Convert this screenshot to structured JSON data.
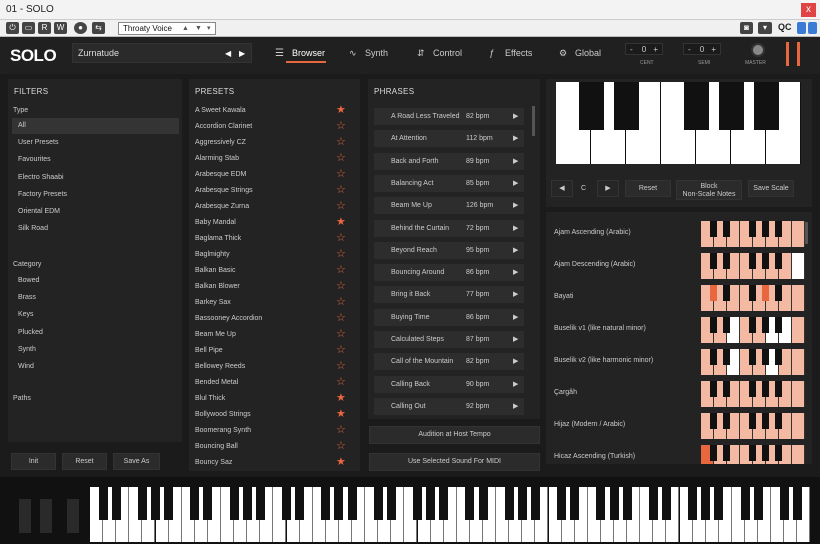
{
  "window": {
    "title": "01 - SOLO",
    "close": "x"
  },
  "host": {
    "preset": "Throaty Voice",
    "qc": "QC"
  },
  "header": {
    "logo": "SOLO",
    "instrument": "Zurnatude",
    "tabs": [
      "Browser",
      "Synth",
      "Control",
      "Effects",
      "Global"
    ],
    "cent_value": "0",
    "cent_label": "CENT",
    "semi_value": "0",
    "semi_label": "SEMI",
    "master_label": "MASTER"
  },
  "filters": {
    "title": "FILTERS",
    "type_label": "Type",
    "types": [
      "All",
      "User Presets",
      "Favourites",
      "Electro Shaabi",
      "Factory Presets",
      "Oriental EDM",
      "Silk Road"
    ],
    "category_label": "Category",
    "categories": [
      "Bowed",
      "Brass",
      "Keys",
      "Plucked",
      "Synth",
      "Wind"
    ],
    "paths_label": "Paths",
    "buttons": [
      "Init",
      "Reset",
      "Save As"
    ]
  },
  "presets": {
    "title": "PRESETS",
    "items": [
      {
        "name": "A Sweet Kawala",
        "fav": true
      },
      {
        "name": "Accordion Clarinet",
        "fav": false
      },
      {
        "name": "Aggressively CZ",
        "fav": false
      },
      {
        "name": "Alarming Stab",
        "fav": false
      },
      {
        "name": "Arabesque EDM",
        "fav": false
      },
      {
        "name": "Arabesque Strings",
        "fav": false
      },
      {
        "name": "Arabesque Zurna",
        "fav": false
      },
      {
        "name": "Baby Mandal",
        "fav": true
      },
      {
        "name": "Baglama Thick",
        "fav": false
      },
      {
        "name": "Baglmighty",
        "fav": false
      },
      {
        "name": "Balkan Basic",
        "fav": false
      },
      {
        "name": "Balkan Blower",
        "fav": false
      },
      {
        "name": "Barkey Sax",
        "fav": false
      },
      {
        "name": "Bassooney Accordion",
        "fav": false
      },
      {
        "name": "Beam Me Up",
        "fav": false
      },
      {
        "name": "Bell Pipe",
        "fav": false
      },
      {
        "name": "Bellowey Reeds",
        "fav": false
      },
      {
        "name": "Bended Metal",
        "fav": false
      },
      {
        "name": "Blul Thick",
        "fav": true
      },
      {
        "name": "Bollywood Strings",
        "fav": true
      },
      {
        "name": "Boomerang Synth",
        "fav": false
      },
      {
        "name": "Bouncing Ball",
        "fav": false
      },
      {
        "name": "Bouncy Saz",
        "fav": true
      }
    ]
  },
  "phrases": {
    "title": "PHRASES",
    "items": [
      {
        "name": "A Road Less Traveled",
        "bpm": "82 bpm"
      },
      {
        "name": "At Attention",
        "bpm": "112 bpm"
      },
      {
        "name": "Back and Forth",
        "bpm": "89 bpm"
      },
      {
        "name": "Balancing Act",
        "bpm": "85 bpm"
      },
      {
        "name": "Beam Me Up",
        "bpm": "126 bpm"
      },
      {
        "name": "Behind the Curtain",
        "bpm": "72 bpm"
      },
      {
        "name": "Beyond Reach",
        "bpm": "95 bpm"
      },
      {
        "name": "Bouncing Around",
        "bpm": "86 bpm"
      },
      {
        "name": "Bring it Back",
        "bpm": "77 bpm"
      },
      {
        "name": "Buying Time",
        "bpm": "86 bpm"
      },
      {
        "name": "Calculated Steps",
        "bpm": "87 bpm"
      },
      {
        "name": "Call of the Mountain",
        "bpm": "82 bpm"
      },
      {
        "name": "Calling Back",
        "bpm": "90 bpm"
      },
      {
        "name": "Calling Out",
        "bpm": "92 bpm"
      }
    ],
    "audition": "Audition at Host Tempo",
    "use_midi": "Use Selected Sound For MIDI"
  },
  "scale": {
    "key": "C",
    "reset": "Reset",
    "block1": "Block",
    "block2": "Non-Scale Notes",
    "save": "Save Scale",
    "items": [
      {
        "name": "Ajam Ascending (Arabic)",
        "w": [
          1,
          1,
          1,
          1,
          1,
          1,
          1,
          1
        ],
        "wd": [],
        "b": [
          1,
          1,
          0,
          1,
          1
        ]
      },
      {
        "name": "Ajam Descending (Arabic)",
        "w": [
          1,
          1,
          1,
          1,
          1,
          1,
          1,
          0
        ],
        "wd": [],
        "b": [
          0,
          0,
          0,
          1,
          1
        ]
      },
      {
        "name": "Bayati",
        "w": [
          1,
          1,
          1,
          1,
          1,
          1,
          1,
          1
        ],
        "wd": [],
        "b": [
          2,
          0,
          0,
          2,
          0
        ]
      },
      {
        "name": "Buselik v1 (like natural minor)",
        "w": [
          1,
          1,
          0,
          1,
          1,
          0,
          0,
          1
        ],
        "wd": [],
        "b": [
          0,
          1,
          0,
          1,
          1
        ]
      },
      {
        "name": "Buselik v2 (like harmonic minor)",
        "w": [
          1,
          1,
          0,
          1,
          1,
          0,
          1,
          1
        ],
        "wd": [],
        "b": [
          0,
          1,
          0,
          1,
          0
        ]
      },
      {
        "name": "Çargâh",
        "w": [
          1,
          1,
          1,
          1,
          1,
          1,
          1,
          1
        ],
        "wd": [],
        "b": [
          0,
          0,
          0,
          0,
          0
        ]
      },
      {
        "name": "Hijaz (Modern / Arabic)",
        "w": [
          1,
          1,
          1,
          1,
          1,
          1,
          1,
          1
        ],
        "wd": [],
        "b": [
          1,
          0,
          0,
          1,
          0
        ]
      },
      {
        "name": "Hicaz Ascending (Turkish)",
        "w": [
          1,
          1,
          1,
          1,
          1,
          1,
          1,
          1
        ],
        "wd": [
          0
        ],
        "b": [
          1,
          0,
          0,
          1,
          0
        ]
      }
    ]
  }
}
